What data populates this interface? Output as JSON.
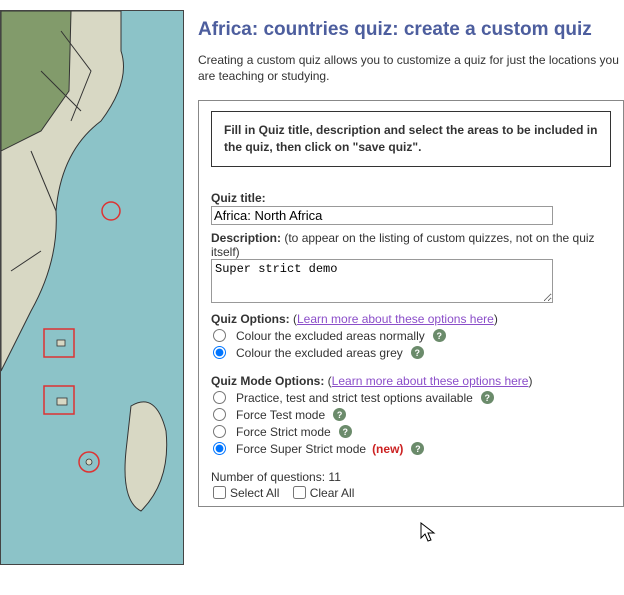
{
  "page": {
    "title": "Africa: countries quiz: create a custom quiz",
    "intro": "Creating a custom quiz allows you to customize a quiz for just the locations you are teaching or studying."
  },
  "notice": "Fill in Quiz title, description and select the areas to be included in the quiz, then click on \"save quiz\".",
  "fields": {
    "quiz_title_label": "Quiz title:",
    "quiz_title_value": "Africa: North Africa",
    "description_label": "Description:",
    "description_hint": " (to appear on the listing of custom quizzes, not on the quiz itself)",
    "description_value": "Super strict demo"
  },
  "quiz_options": {
    "label": "Quiz Options:",
    "learn_text": "Learn more about these options here",
    "items": [
      {
        "label": "Colour the excluded areas normally",
        "checked": false
      },
      {
        "label": "Colour the excluded areas grey",
        "checked": true
      }
    ]
  },
  "mode_options": {
    "label": "Quiz Mode Options:",
    "learn_text": "Learn more about these options here",
    "items": [
      {
        "label": "Practice, test and strict test options available",
        "checked": false,
        "new": false
      },
      {
        "label": "Force Test mode",
        "checked": false,
        "new": false
      },
      {
        "label": "Force Strict mode",
        "checked": false,
        "new": false
      },
      {
        "label": "Force Super Strict mode",
        "checked": true,
        "new": true
      }
    ],
    "new_tag": "(new)"
  },
  "footer": {
    "num_questions_label": "Number of questions: ",
    "num_questions_value": "11",
    "select_all": "Select All",
    "clear_all": "Clear All"
  }
}
